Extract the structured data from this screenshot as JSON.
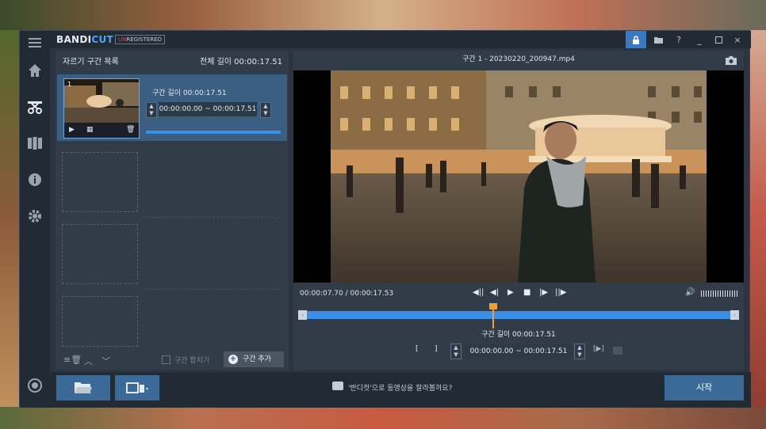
{
  "app": {
    "logo_main": "BANDI",
    "logo_accent": "CUT",
    "unregistered_un": "UN",
    "unregistered_rest": "REGISTERED"
  },
  "titlebar": {
    "help": "?",
    "minimize": "_",
    "close": "×"
  },
  "left_panel": {
    "title": "자르기 구간 목록",
    "total_length": "전체 길이 00:00:17.51",
    "segment": {
      "index": "1",
      "length_label": "구간 길이 00:00:17.51",
      "range": "00:00:00.00  ~  00:00:17.51"
    },
    "merge_label": "구간 합치기",
    "add_label": "구간 추가"
  },
  "right_panel": {
    "header": "구간 1 - 20230220_200947.mp4",
    "time_readout": "00:00:07.70 / 00:00:17.53",
    "segment_length": "구간 길이 00:00:17.51",
    "range": "00:00:00.00  ~  00:00:17.51",
    "playhead_fraction": 0.44
  },
  "bottom": {
    "hint": "'반디컷'으로 동영상을 잘라볼까요?",
    "start_label": "시작"
  },
  "colors": {
    "accent": "#3b8fe6",
    "playhead": "#f0a030",
    "panel": "#323c48"
  }
}
